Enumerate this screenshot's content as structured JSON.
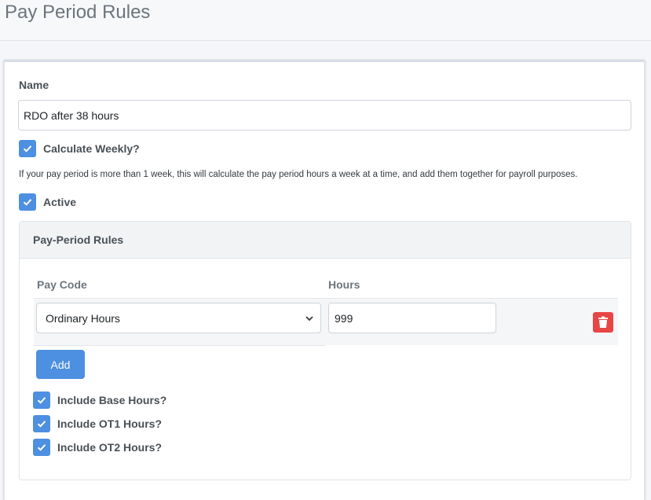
{
  "header": {
    "title": "Pay Period Rules"
  },
  "form": {
    "name_label": "Name",
    "name_value": "RDO after 38 hours",
    "calculate_weekly": {
      "label": "Calculate Weekly?",
      "checked": true
    },
    "help_text": "If your pay period is more than 1 week, this will calculate the pay period hours a week at a time, and add them together for payroll purposes.",
    "active": {
      "label": "Active",
      "checked": true
    }
  },
  "rules_card": {
    "title": "Pay-Period Rules",
    "columns": [
      "Pay Code",
      "Hours"
    ],
    "rows": [
      {
        "pay_code": "Ordinary Hours",
        "hours": "999"
      }
    ],
    "add_label": "Add",
    "options": [
      {
        "label": "Include Base Hours?",
        "checked": true
      },
      {
        "label": "Include OT1 Hours?",
        "checked": true
      },
      {
        "label": "Include OT2 Hours?",
        "checked": true
      }
    ]
  },
  "colors": {
    "primary": "#4d8fe0",
    "danger": "#e84545"
  }
}
